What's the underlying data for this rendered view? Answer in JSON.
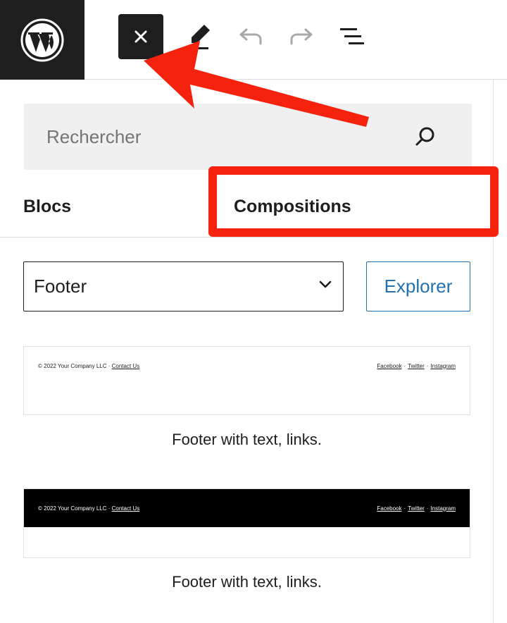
{
  "toolbar": {
    "logo_icon": "wordpress-logo-icon",
    "close_icon": "close-icon",
    "edit_icon": "pencil-icon",
    "undo_icon": "undo-icon",
    "redo_icon": "redo-icon",
    "list_view_icon": "list-view-icon"
  },
  "inserter": {
    "search": {
      "placeholder": "Rechercher",
      "value": "",
      "icon": "search-icon"
    },
    "tabs": [
      {
        "label": "Blocs",
        "active": false
      },
      {
        "label": "Compositions",
        "active": true
      }
    ],
    "category": {
      "selected": "Footer",
      "icon": "chevron-down-icon"
    },
    "explore_label": "Explorer",
    "patterns": [
      {
        "left_text": "© 2022 Your Company LLC · ",
        "left_link": "Contact Us",
        "links": [
          "Facebook",
          "Twitter",
          "Instagram"
        ],
        "separator": "·",
        "caption": "Footer with text, links.",
        "theme": "light"
      },
      {
        "left_text": "© 2022 Your Company LLC · ",
        "left_link": "Contact Us",
        "links": [
          "Facebook",
          "Twitter",
          "Instagram"
        ],
        "separator": "·",
        "caption": "Footer with text, links.",
        "theme": "dark"
      }
    ]
  },
  "colors": {
    "annotation_red": "#f5230e",
    "toolbar_dark": "#1e1e1e",
    "accent_blue": "#2271b1",
    "search_bg": "#f0f0f0"
  }
}
